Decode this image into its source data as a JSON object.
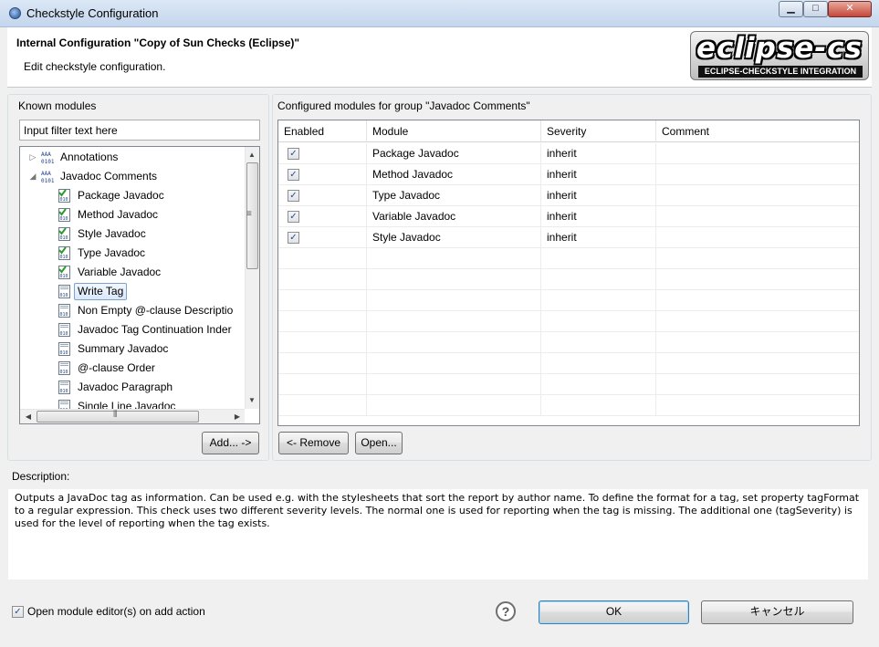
{
  "window": {
    "title": "Checkstyle Configuration",
    "min_label": "▁",
    "max_label": "□",
    "close_label": "✕"
  },
  "header": {
    "title": "Internal Configuration \"Copy of Sun Checks (Eclipse)\"",
    "subtitle": "Edit checkstyle configuration.",
    "logo_main": "eclipse-cs",
    "logo_sub": "ECLIPSE-CHECKSTYLE INTEGRATION"
  },
  "known_modules": {
    "label": "Known modules",
    "filter_placeholder": "Input filter text here",
    "tree": [
      {
        "label": "Annotations",
        "arrow": "▷",
        "icon": "module-group-icon"
      },
      {
        "label": "Javadoc Comments",
        "arrow": "◢",
        "icon": "module-group-icon"
      },
      {
        "label": "Package Javadoc",
        "icon": "module-checked-icon"
      },
      {
        "label": "Method Javadoc",
        "icon": "module-checked-icon"
      },
      {
        "label": "Style Javadoc",
        "icon": "module-checked-icon"
      },
      {
        "label": "Type Javadoc",
        "icon": "module-checked-icon"
      },
      {
        "label": "Variable Javadoc",
        "icon": "module-checked-icon"
      },
      {
        "label": "Write Tag",
        "icon": "module-icon"
      },
      {
        "label": "Non Empty @-clause Descriptio",
        "icon": "module-icon"
      },
      {
        "label": "Javadoc Tag Continuation Inder",
        "icon": "module-icon"
      },
      {
        "label": "Summary Javadoc",
        "icon": "module-icon"
      },
      {
        "label": "@-clause Order",
        "icon": "module-icon"
      },
      {
        "label": "Javadoc Paragraph",
        "icon": "module-icon"
      },
      {
        "label": "Single Line Javadoc",
        "icon": "module-icon"
      }
    ],
    "selected_item": "Write Tag",
    "add_button": "Add... ->"
  },
  "configured_modules": {
    "label": "Configured modules for group \"Javadoc Comments\"",
    "columns": [
      "Enabled",
      "Module",
      "Severity",
      "Comment"
    ],
    "rows": [
      {
        "enabled": true,
        "module": "Package Javadoc",
        "severity": "inherit",
        "comment": ""
      },
      {
        "enabled": true,
        "module": "Method Javadoc",
        "severity": "inherit",
        "comment": ""
      },
      {
        "enabled": true,
        "module": "Type Javadoc",
        "severity": "inherit",
        "comment": ""
      },
      {
        "enabled": true,
        "module": "Variable Javadoc",
        "severity": "inherit",
        "comment": ""
      },
      {
        "enabled": true,
        "module": "Style Javadoc",
        "severity": "inherit",
        "comment": ""
      }
    ],
    "remove_button": "<- Remove",
    "open_button": "Open..."
  },
  "description": {
    "label": "Description:",
    "text": "Outputs a JavaDoc tag as information. Can be used e.g. with the stylesheets that sort the report by author name. To define the format for a tag, set property tagFormat to a regular expression. This check uses two different severity levels. The normal one is used for reporting when the tag is missing. The additional one (tagSeverity) is used for the level of reporting when the tag exists."
  },
  "footer": {
    "open_editor_checked": true,
    "open_editor_label": "Open module editor(s) on add action",
    "help_label": "?",
    "ok_button": "OK",
    "cancel_button": "キャンセル"
  },
  "colors": {
    "titlebar": "#c4d6ed",
    "selection": "#d9e8fb",
    "checkbox_mark": "#2a4e8a"
  }
}
